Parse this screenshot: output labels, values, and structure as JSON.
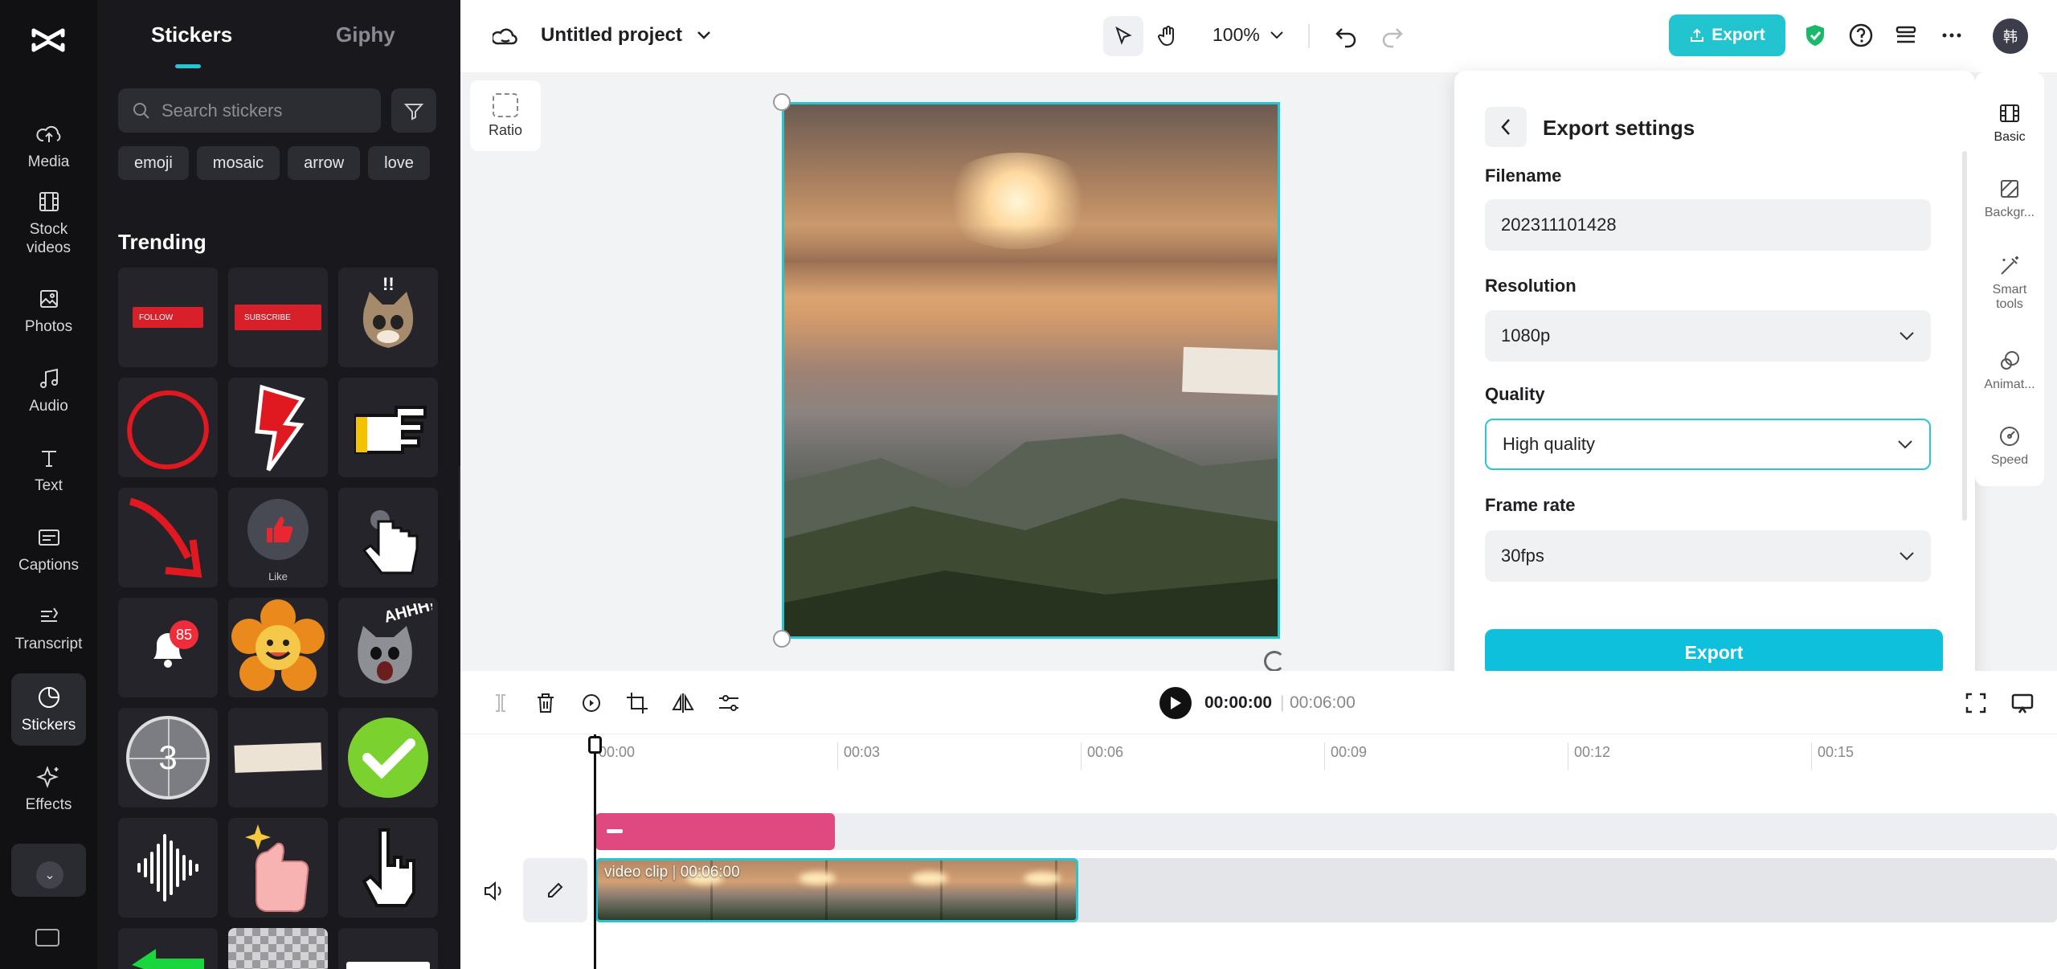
{
  "nav": {
    "items": [
      {
        "label": "Media",
        "icon": "cloud-upload-icon"
      },
      {
        "label": "Stock\nvideos",
        "icon": "film-icon"
      },
      {
        "label": "Photos",
        "icon": "image-icon"
      },
      {
        "label": "Audio",
        "icon": "music-note-icon"
      },
      {
        "label": "Text",
        "icon": "text-icon"
      },
      {
        "label": "Captions",
        "icon": "captions-icon"
      },
      {
        "label": "Transcript",
        "icon": "transcript-icon"
      },
      {
        "label": "Stickers",
        "icon": "sticker-icon",
        "active": true
      },
      {
        "label": "Effects",
        "icon": "sparkle-icon"
      }
    ]
  },
  "panel": {
    "tabs": [
      "Stickers",
      "Giphy"
    ],
    "active_tab": "Stickers",
    "search_placeholder": "Search stickers",
    "chips": [
      "emoji",
      "mosaic",
      "arrow",
      "love"
    ],
    "section_title": "Trending",
    "stickers": [
      {
        "name": "follow-button",
        "text": "FOLLOW"
      },
      {
        "name": "subscribe-button",
        "text": "SUBSCRIBE"
      },
      {
        "name": "surprised-cat"
      },
      {
        "name": "red-circle"
      },
      {
        "name": "red-lightning"
      },
      {
        "name": "pixel-pointing-hand"
      },
      {
        "name": "red-arrow"
      },
      {
        "name": "like-thumb",
        "caption": "Like"
      },
      {
        "name": "clicking-hand"
      },
      {
        "name": "notification-bell",
        "badge": "85"
      },
      {
        "name": "smiling-flower"
      },
      {
        "name": "screaming-cat",
        "text": "AHHH!!"
      },
      {
        "name": "countdown-3",
        "text": "3"
      },
      {
        "name": "tape-strip"
      },
      {
        "name": "green-check"
      },
      {
        "name": "sound-wave"
      },
      {
        "name": "thumbs-up-sparkle"
      },
      {
        "name": "pixel-hand-cursor"
      },
      {
        "name": "green-arrow"
      },
      {
        "name": "mosaic-block"
      },
      {
        "name": "white-box"
      }
    ]
  },
  "topbar": {
    "project_title": "Untitled project",
    "zoom": "100%",
    "export_label": "Export",
    "avatar_initial": "韩"
  },
  "canvas": {
    "ratio_label": "Ratio"
  },
  "export_panel": {
    "title": "Export settings",
    "filename_label": "Filename",
    "filename_value": "202311101428",
    "resolution_label": "Resolution",
    "resolution_value": "1080p",
    "quality_label": "Quality",
    "quality_value": "High quality",
    "framerate_label": "Frame rate",
    "framerate_value": "30fps",
    "export_button": "Export"
  },
  "props": [
    {
      "label": "Basic",
      "icon": "film-strip-icon",
      "active": true
    },
    {
      "label": "Backgr...",
      "icon": "background-icon"
    },
    {
      "label": "Smart\ntools",
      "icon": "magic-wand-icon"
    },
    {
      "label": "Animat...",
      "icon": "animation-icon"
    },
    {
      "label": "Speed",
      "icon": "speedometer-icon"
    }
  ],
  "timeline": {
    "current_time": "00:00:00",
    "total_time": "00:06:00",
    "ticks": [
      "00:00",
      "00:03",
      "00:06",
      "00:09",
      "00:12",
      "00:15"
    ],
    "video_clip_label": "video clip",
    "video_clip_duration": "00:06:00"
  }
}
